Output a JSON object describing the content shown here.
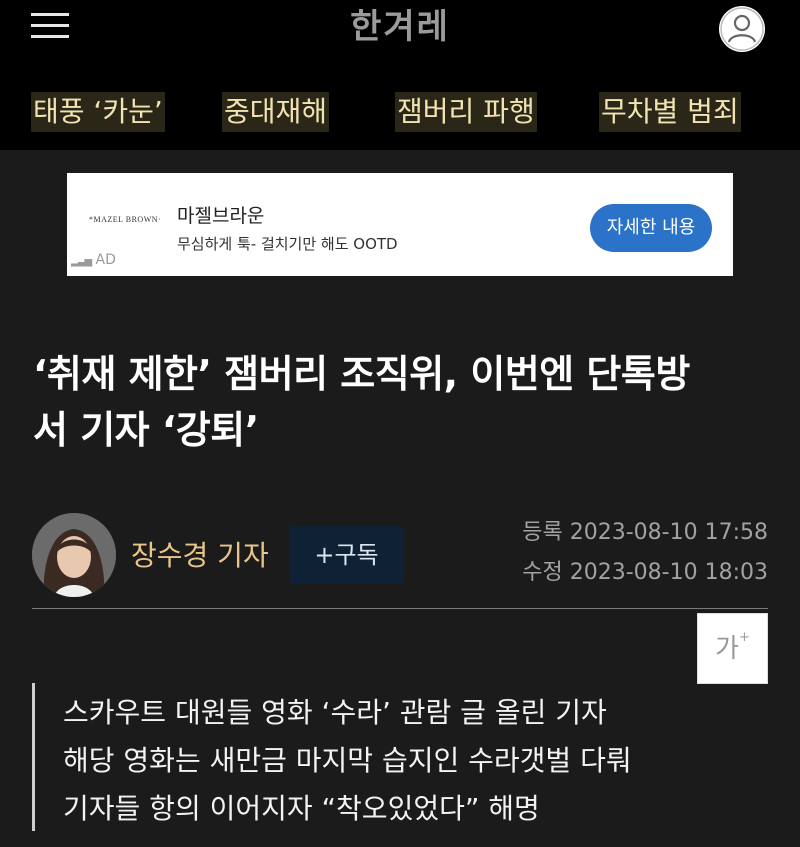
{
  "header": {
    "logo": "한겨레",
    "menu_icon": "hamburger-menu-icon",
    "user_icon": "user-icon"
  },
  "topics": [
    "태풍 ‘카눈’",
    "중대재해",
    "잼버리 파행",
    "무차별 범죄"
  ],
  "ad": {
    "brand": "*MAZEL BROWN·",
    "title": "마젤브라운",
    "description": "무심하게 툭- 걸치기만 해도 OOTD",
    "label": "AD",
    "button": "자세한 내용",
    "button_color": "#2b73c9"
  },
  "article": {
    "headline_line1": "‘취재 제한’ 잼버리 조직위, 이번엔 단톡방",
    "headline_line2": "서 기자 ‘강퇴’",
    "author": "장수경 기자",
    "subscribe": "+구독",
    "registered": "등록 2023-08-10 17:58",
    "modified": "수정 2023-08-10 18:03",
    "font_size_button": "가",
    "font_size_sup": "+",
    "subtitles": [
      "스카우트 대원들 영화 ‘수라’ 관람 글 올린 기자",
      "해당 영화는 새만금 마지막 습지인 수라갯벌 다뤄",
      "기자들 항의 이어지자 “착오있었다” 해명"
    ]
  },
  "colors": {
    "topic_text": "#f2e3b0",
    "author_name": "#e8c58a",
    "subscribe_bg": "#0f2134"
  }
}
